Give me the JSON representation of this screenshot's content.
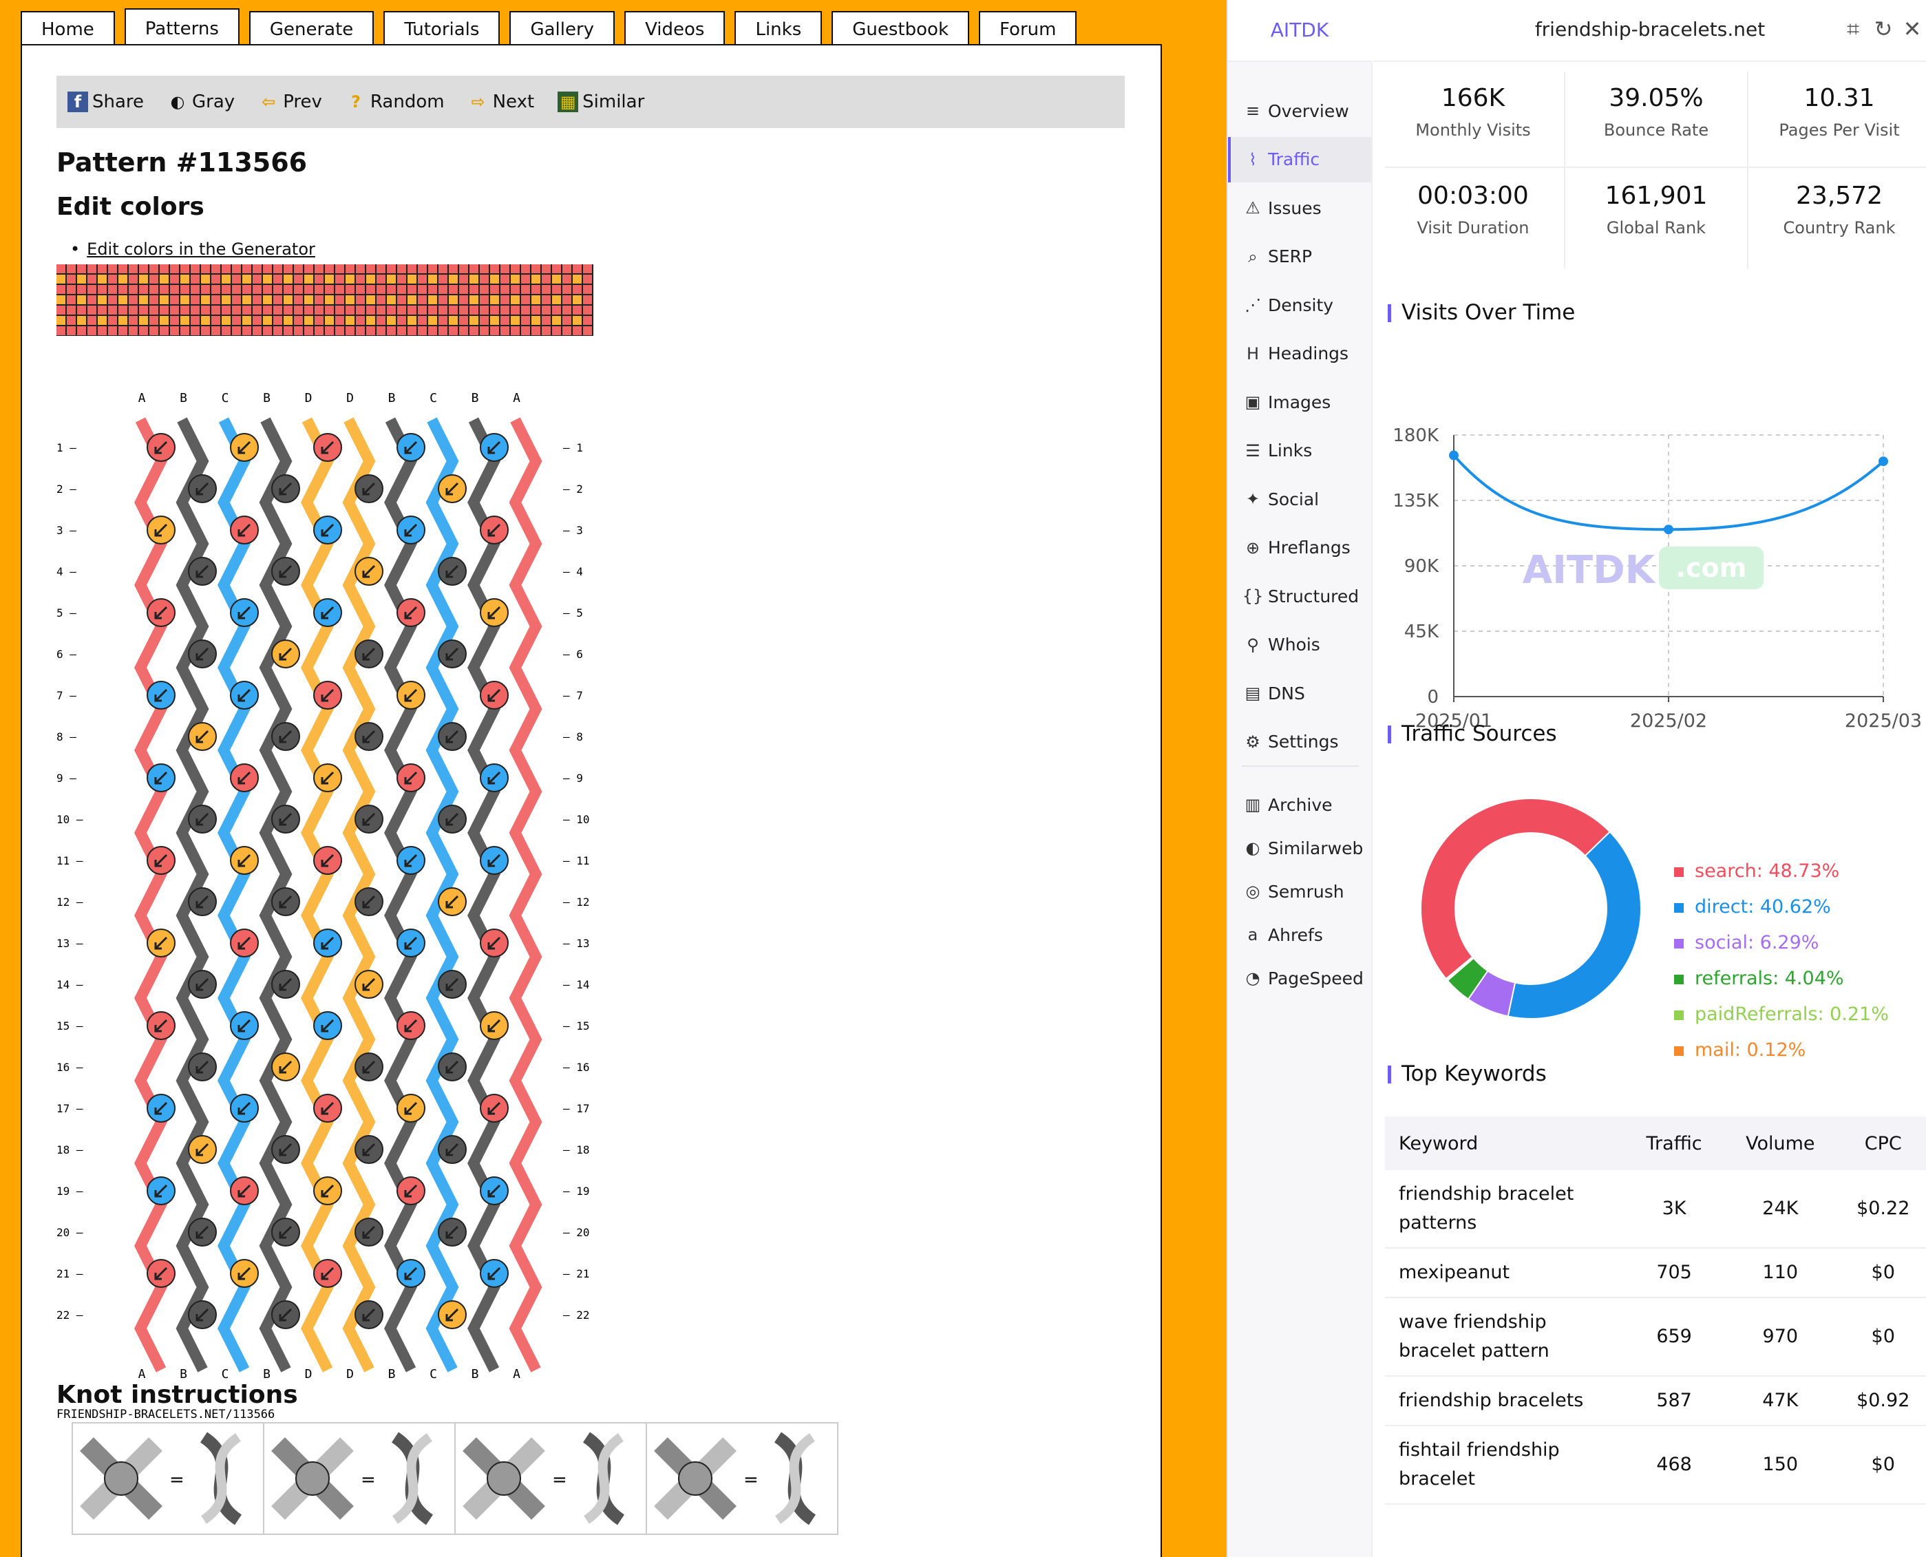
{
  "site": {
    "tabs": [
      "Home",
      "Patterns",
      "Generate",
      "Tutorials",
      "Gallery",
      "Videos",
      "Links",
      "Guestbook",
      "Forum"
    ],
    "active_tab": "Patterns",
    "toolbar": {
      "share": "Share",
      "gray": "Gray",
      "prev": "Prev",
      "random": "Random",
      "next": "Next",
      "similar": "Similar"
    },
    "pattern_title": "Pattern #113566",
    "edit_colors_heading": "Edit colors",
    "edit_link": "Edit colors in the Generator",
    "string_labels": [
      "A",
      "B",
      "C",
      "B",
      "D",
      "D",
      "B",
      "C",
      "B",
      "A"
    ],
    "row_numbers": [
      "1",
      "2",
      "3",
      "4",
      "5",
      "6",
      "7",
      "8",
      "9",
      "10",
      "11",
      "12",
      "13",
      "14",
      "15",
      "16",
      "17",
      "18",
      "19",
      "20",
      "21",
      "22"
    ],
    "watermark": "FRIENDSHIP-BRACELETS.NET/113566",
    "knot_heading": "Knot instructions",
    "colors": {
      "A": "#f06464",
      "B": "#555555",
      "C": "#36a9f2",
      "D": "#fbb33a"
    }
  },
  "panel": {
    "brand": "AITDK",
    "domain": "friendship-bracelets.net",
    "header_icons": [
      "crop-icon",
      "refresh-icon",
      "close-icon"
    ],
    "nav": [
      {
        "label": "Overview",
        "icon": "≡"
      },
      {
        "label": "Traffic",
        "icon": "⌇",
        "active": true
      },
      {
        "label": "Issues",
        "icon": "⚠"
      },
      {
        "label": "SERP",
        "icon": "⌕"
      },
      {
        "label": "Density",
        "icon": "⋰"
      },
      {
        "label": "Headings",
        "icon": "H"
      },
      {
        "label": "Images",
        "icon": "▣"
      },
      {
        "label": "Links",
        "icon": "☰"
      },
      {
        "label": "Social",
        "icon": "✦"
      },
      {
        "label": "Hreflangs",
        "icon": "⊕"
      },
      {
        "label": "Structured",
        "icon": "{}"
      },
      {
        "label": "Whois",
        "icon": "⚲"
      },
      {
        "label": "DNS",
        "icon": "▤"
      },
      {
        "label": "Settings",
        "icon": "⚙"
      }
    ],
    "tools": [
      {
        "label": "Archive",
        "icon": "▥"
      },
      {
        "label": "Similarweb",
        "icon": "◐"
      },
      {
        "label": "Semrush",
        "icon": "◎"
      },
      {
        "label": "Ahrefs",
        "icon": "a"
      },
      {
        "label": "PageSpeed",
        "icon": "◔"
      }
    ],
    "stats": [
      {
        "value": "166K",
        "label": "Monthly Visits"
      },
      {
        "value": "39.05%",
        "label": "Bounce Rate"
      },
      {
        "value": "10.31",
        "label": "Pages Per Visit"
      },
      {
        "value": "00:03:00",
        "label": "Visit Duration"
      },
      {
        "value": "161,901",
        "label": "Global Rank"
      },
      {
        "value": "23,572",
        "label": "Country Rank"
      }
    ],
    "visits_title": "Visits Over Time",
    "sources_title": "Traffic Sources",
    "keywords_title": "Top Keywords",
    "chart_watermark": "AITDK",
    "chart_watermark_suffix": ".com",
    "keyword_headers": [
      "Keyword",
      "Traffic",
      "Volume",
      "CPC"
    ],
    "keywords": [
      [
        "friendship bracelet patterns",
        "3K",
        "24K",
        "$0.22"
      ],
      [
        "mexipeanut",
        "705",
        "110",
        "$0"
      ],
      [
        "wave friendship bracelet pattern",
        "659",
        "970",
        "$0"
      ],
      [
        "friendship bracelets",
        "587",
        "47K",
        "$0.92"
      ],
      [
        "fishtail friendship bracelet",
        "468",
        "150",
        "$0"
      ]
    ]
  },
  "chart_data": [
    {
      "type": "line",
      "title": "Visits Over Time",
      "categories": [
        "2025/01",
        "2025/02",
        "2025/03"
      ],
      "values": [
        166000,
        115000,
        161901
      ],
      "ylim": [
        0,
        180000
      ],
      "yticks": [
        "0",
        "45K",
        "90K",
        "135K",
        "180K"
      ],
      "grid": true,
      "color": "#1a8fe8"
    },
    {
      "type": "pie",
      "title": "Traffic Sources",
      "legend_position": "right",
      "slices": [
        {
          "label": "search: 48.73%",
          "name": "search",
          "value": 48.73,
          "color": "#f04e5e"
        },
        {
          "label": "direct: 40.62%",
          "name": "direct",
          "value": 40.62,
          "color": "#1a8fe8"
        },
        {
          "label": "social: 6.29%",
          "name": "social",
          "value": 6.29,
          "color": "#a66cf2"
        },
        {
          "label": "referrals: 4.04%",
          "name": "referrals",
          "value": 4.04,
          "color": "#2ea52e"
        },
        {
          "label": "paidReferrals: 0.21%",
          "name": "paidReferrals",
          "value": 0.21,
          "color": "#92d050"
        },
        {
          "label": "mail: 0.12%",
          "name": "mail",
          "value": 0.12,
          "color": "#f5882a"
        }
      ]
    }
  ]
}
